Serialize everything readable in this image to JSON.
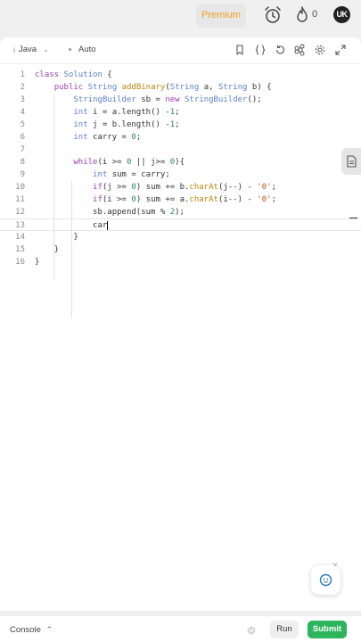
{
  "header": {
    "premium_label": "Premium",
    "streak_count": "0",
    "avatar_initials": "UK"
  },
  "editor": {
    "language": "Java",
    "mode": "Auto",
    "lines": [
      {
        "n": "1",
        "html": "<span class=\"kw\">class</span> <span class=\"tp\">Solution</span> {"
      },
      {
        "n": "2",
        "html": "    <span class=\"kw\">public</span> <span class=\"tp\">String</span> <span class=\"fn\">addBinary</span>(<span class=\"tp\">String</span> a, <span class=\"tp\">String</span> b) {"
      },
      {
        "n": "3",
        "html": "        <span class=\"tp\">StringBuilder</span> sb = <span class=\"kw\">new</span> <span class=\"tp\">StringBuilder</span>();"
      },
      {
        "n": "4",
        "html": "        <span class=\"tp\">int</span> i = a.length() -<span class=\"num\">1</span>;"
      },
      {
        "n": "5",
        "html": "        <span class=\"tp\">int</span> j = b.length() -<span class=\"num\">1</span>;"
      },
      {
        "n": "6",
        "html": "        <span class=\"tp\">int</span> carry = <span class=\"num\">0</span>;"
      },
      {
        "n": "7",
        "html": ""
      },
      {
        "n": "8",
        "html": "        <span class=\"kw\">while</span>(i >= <span class=\"num\">0</span> || j>= <span class=\"num\">0</span>){"
      },
      {
        "n": "9",
        "html": "            <span class=\"tp\">int</span> sum = carry;"
      },
      {
        "n": "10",
        "html": "            <span class=\"kw\">if</span>(j >= <span class=\"num\">0</span>) sum += b.<span class=\"fn\">charAt</span>(j--) - <span class=\"str\">'0'</span>;"
      },
      {
        "n": "11",
        "html": "            <span class=\"kw\">if</span>(i >= <span class=\"num\">0</span>) sum += a.<span class=\"fn\">charAt</span>(i--) - <span class=\"str\">'0'</span>;"
      },
      {
        "n": "12",
        "html": "            sb.append(sum % <span class=\"num\">2</span>);"
      },
      {
        "n": "13",
        "html": "            car<span class=\"caret\"></span>"
      },
      {
        "n": "14",
        "html": "        }"
      },
      {
        "n": "15",
        "html": "    }"
      },
      {
        "n": "16",
        "html": "}"
      }
    ]
  },
  "footer": {
    "console_label": "Console",
    "run_label": "Run",
    "submit_label": "Submit"
  },
  "colors": {
    "accent_green": "#2db55d",
    "premium_orange": "#f0a020"
  }
}
